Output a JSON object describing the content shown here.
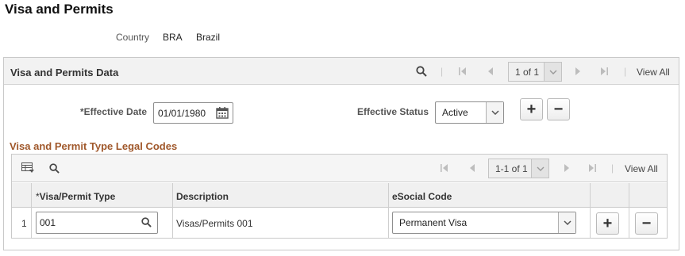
{
  "page": {
    "title": "Visa and Permits",
    "country_label": "Country",
    "country_code": "BRA",
    "country_name": "Brazil"
  },
  "visa_panel": {
    "title": "Visa and Permits Data",
    "pager": "1 of 1",
    "view_all": "View All",
    "effective_date_label": "*Effective Date",
    "effective_date_value": "01/01/1980",
    "effective_status_label": "Effective Status",
    "effective_status_value": "Active",
    "add_label": "+",
    "remove_label": "−"
  },
  "legal_codes": {
    "title": "Visa and Permit Type Legal Codes",
    "pager": "1-1 of 1",
    "view_all": "View All",
    "columns": {
      "type_star": "*",
      "type": "Visa/Permit Type",
      "description": "Description",
      "esocial": "eSocial Code"
    },
    "rows": [
      {
        "num": "1",
        "type": "001",
        "description": "Visas/Permits 001",
        "esocial": "Permanent Visa",
        "add_label": "+",
        "remove_label": "−"
      }
    ]
  },
  "colors": {
    "section_title": "#a0582b",
    "header_bg": "#f2f2f2",
    "border": "#c9c9c9"
  },
  "icons": [
    "search-icon",
    "first-page-icon",
    "prev-page-icon",
    "next-page-icon",
    "last-page-icon",
    "calendar-icon",
    "chevron-down-icon",
    "grid-personalize-icon",
    "lookup-icon"
  ]
}
